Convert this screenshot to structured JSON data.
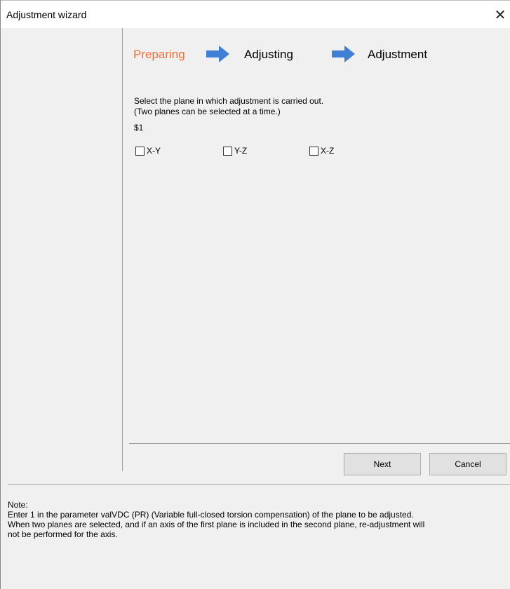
{
  "window": {
    "title": "Adjustment wizard",
    "close_glyph": "✕"
  },
  "steps": [
    {
      "label": "Preparing",
      "active": true
    },
    {
      "label": "Adjusting",
      "active": false
    },
    {
      "label": "Adjustment",
      "active": false
    }
  ],
  "step_arrow_color": "#3f7fd6",
  "active_step_color": "#f0703a",
  "instructions": {
    "line1": "Select the plane in which adjustment is carried out.",
    "line2": " (Two planes can be selected at a time.)",
    "line3": "$1"
  },
  "planes": [
    {
      "label": "X-Y",
      "checked": false
    },
    {
      "label": "Y-Z",
      "checked": false
    },
    {
      "label": "X-Z",
      "checked": false
    }
  ],
  "buttons": {
    "next": "Next",
    "cancel": "Cancel"
  },
  "note": {
    "heading": "Note:",
    "line1": "Enter 1 in the parameter valVDC (PR) (Variable full-closed torsion compensation) of the plane to be adjusted.",
    "line2": "When two planes are selected, and if an axis of the first plane is included in the second plane, re-adjustment will",
    "line3": "not be performed for the axis."
  }
}
